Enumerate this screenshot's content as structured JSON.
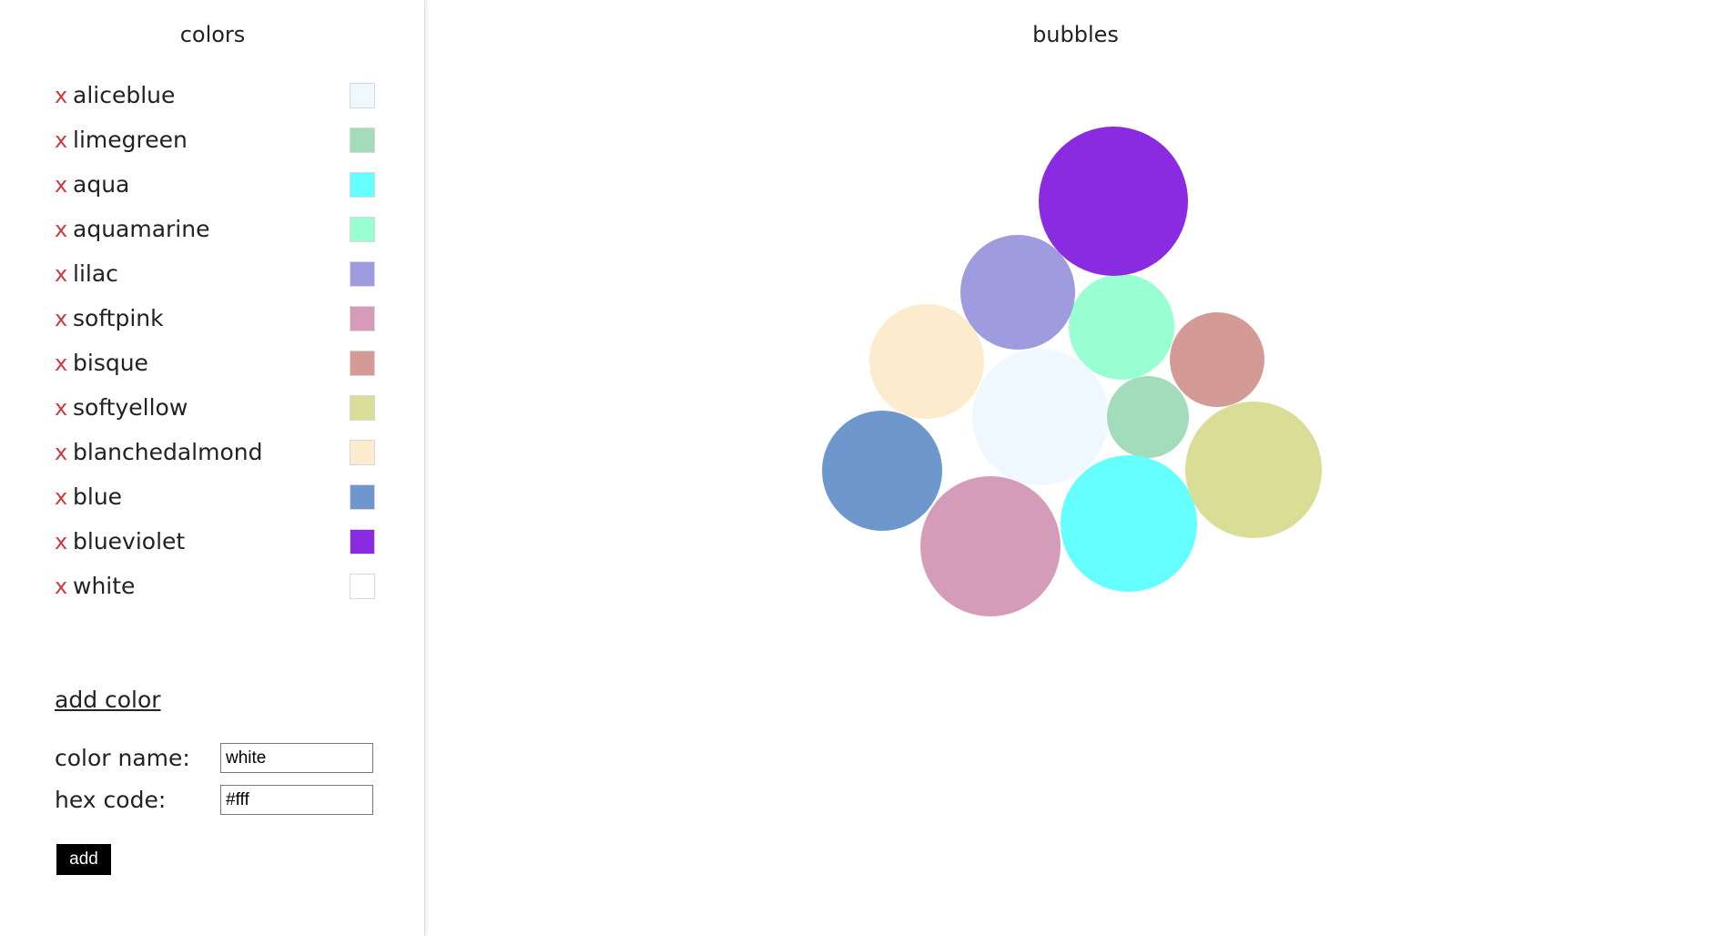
{
  "sidebar": {
    "title": "colors",
    "remove_glyph": "x",
    "colors": [
      {
        "name": "aliceblue",
        "hex": "#f0f8ff"
      },
      {
        "name": "limegreen",
        "hex": "#a2dcbb"
      },
      {
        "name": "aqua",
        "hex": "#66ffff"
      },
      {
        "name": "aquamarine",
        "hex": "#99ffd2"
      },
      {
        "name": "lilac",
        "hex": "#9e9bde"
      },
      {
        "name": "softpink",
        "hex": "#d49cb9"
      },
      {
        "name": "bisque",
        "hex": "#d49a96"
      },
      {
        "name": "softyellow",
        "hex": "#dadd95"
      },
      {
        "name": "blanchedalmond",
        "hex": "#fcebcd"
      },
      {
        "name": "blue",
        "hex": "#6e97cd"
      },
      {
        "name": "blueviolet",
        "hex": "#8a2be2"
      },
      {
        "name": "white",
        "hex": "#ffffff"
      }
    ]
  },
  "add_form": {
    "heading": "add color",
    "name_label": "color name:",
    "name_value": "white",
    "hex_label": "hex code:",
    "hex_value": "#fff",
    "button_label": "add"
  },
  "main": {
    "title": "bubbles"
  }
}
